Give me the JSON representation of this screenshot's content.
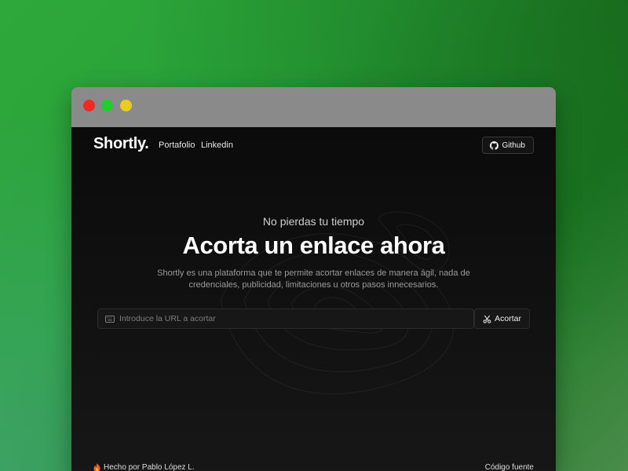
{
  "window": {
    "controls": [
      {
        "name": "close",
        "color": "#ee2a22"
      },
      {
        "name": "maximize",
        "color": "#22cc2a"
      },
      {
        "name": "minimize",
        "color": "#e8cc22"
      }
    ]
  },
  "nav": {
    "logo": "Shortly.",
    "links": [
      "Portafolio",
      "Linkedin"
    ],
    "github_label": "Github",
    "github_icon": "github-icon"
  },
  "hero": {
    "eyebrow": "No pierdas tu tiempo",
    "headline": "Acorta un enlace ahora",
    "description": "Shortly es una plataforma que te permite acortar enlaces de manera ágil, nada de credenciales, publicidad, limitaciones u otros pasos innecesarios."
  },
  "form": {
    "input_icon": "keyboard-icon",
    "placeholder": "Introduce la URL a acortar",
    "value": "",
    "submit_icon": "scissors-icon",
    "submit_label": "Acortar"
  },
  "footer": {
    "icon": "flame-icon",
    "credit": "Hecho por Pablo López L.",
    "source_link": "Código fuente"
  },
  "colors": {
    "background_gradient": "#2fa83a",
    "titlebar": "#8a8a8a",
    "content_bg": "#0b0b0b",
    "flame": "#ff5a2a"
  }
}
